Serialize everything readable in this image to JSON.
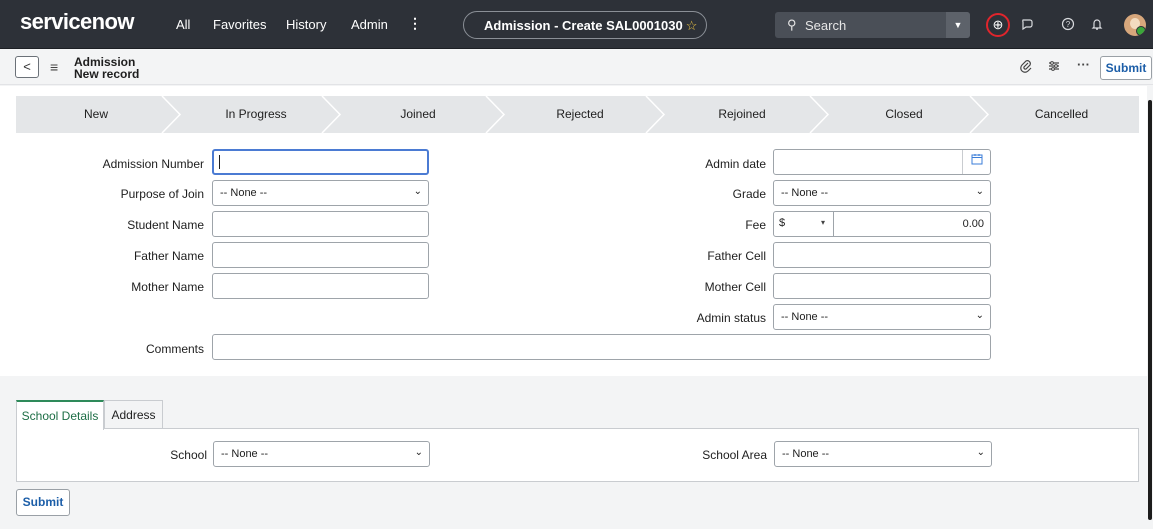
{
  "topbar": {
    "logo": "servicenow",
    "nav": [
      "All",
      "Favorites",
      "History",
      "Admin"
    ],
    "kebab": "⋮",
    "context_title": "Admission - Create SAL0001030",
    "search_label": "Search",
    "colors": {
      "bar": "#2d3138",
      "globe_ring": "#e0252c",
      "star": "#f2c744"
    }
  },
  "header": {
    "table_label": "Admission",
    "record_label": "New record",
    "submit_label": "Submit"
  },
  "stages": [
    "New",
    "In Progress",
    "Joined",
    "Rejected",
    "Rejoined",
    "Closed",
    "Cancelled"
  ],
  "form": {
    "admission_number_label": "Admission Number",
    "admission_number_value": "",
    "purpose_label": "Purpose of Join",
    "purpose_value": "-- None --",
    "student_name_label": "Student Name",
    "father_name_label": "Father Name",
    "mother_name_label": "Mother Name",
    "comments_label": "Comments",
    "admin_date_label": "Admin date",
    "grade_label": "Grade",
    "grade_value": "-- None --",
    "fee_label": "Fee",
    "fee_currency": "$",
    "fee_value": "0.00",
    "father_cell_label": "Father Cell",
    "mother_cell_label": "Mother Cell",
    "admin_status_label": "Admin status",
    "admin_status_value": "-- None --"
  },
  "tabs": {
    "school_details": "School Details",
    "address": "Address",
    "school_label": "School",
    "school_value": "-- None --",
    "school_area_label": "School Area",
    "school_area_value": "-- None --"
  },
  "footer": {
    "submit_label": "Submit"
  }
}
